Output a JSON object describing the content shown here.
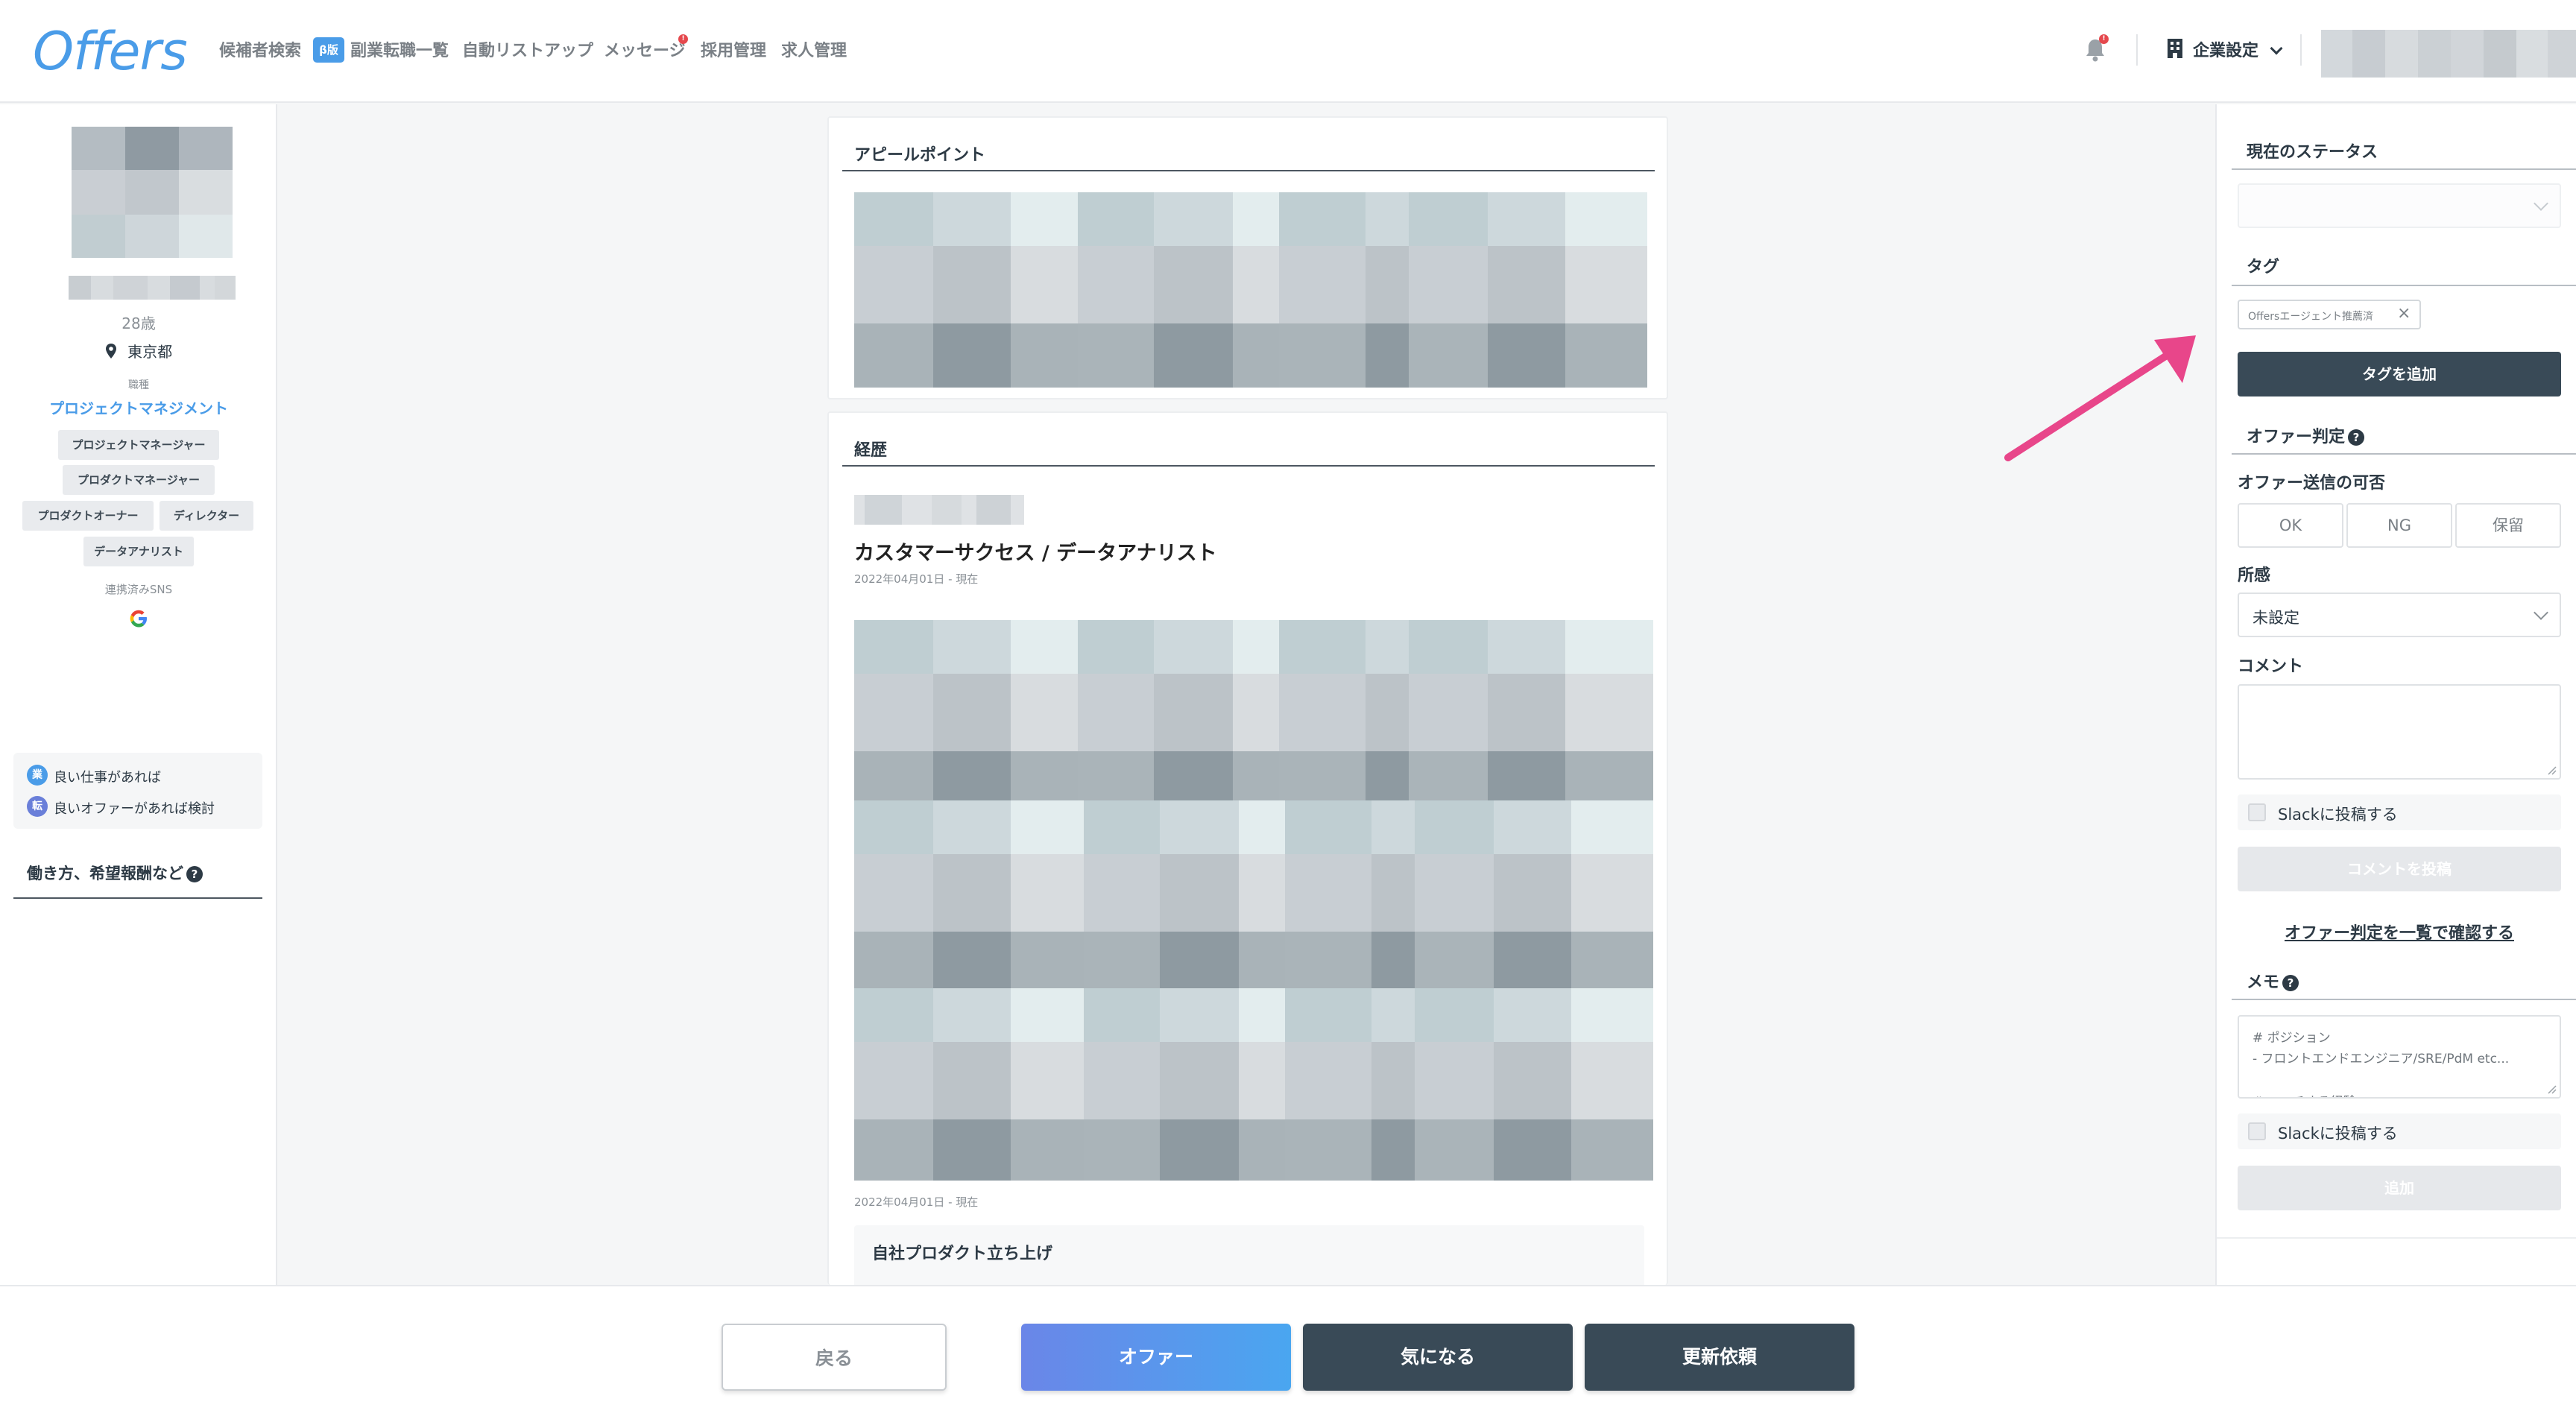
{
  "header": {
    "logo": "Offers",
    "nav": [
      {
        "label": "候補者検索"
      },
      {
        "badge": "β版",
        "label": "副業転職一覧"
      },
      {
        "label": "自動リストアップ"
      },
      {
        "label": "メッセージ",
        "notification": "!"
      },
      {
        "label": "採用管理"
      },
      {
        "label": "求人管理"
      }
    ],
    "bell_notification": "!",
    "company_settings": "企業設定"
  },
  "profile": {
    "age": "28歳",
    "location": "東京都",
    "job_type_label": "職種",
    "job_type": "プロジェクトマネジメント",
    "roles": [
      "プロジェクトマネージャー",
      "プロダクトマネージャー",
      "プロダクトオーナー",
      "ディレクター",
      "データアナリスト"
    ],
    "sns_label": "連携済みSNS",
    "statuses": [
      {
        "icon": "業",
        "text": "良い仕事があれば"
      },
      {
        "icon": "転",
        "text": "良いオファーがあれば検討"
      }
    ],
    "work_style_heading": "働き方、希望報酬など",
    "work_style_help": "?"
  },
  "main": {
    "appeal_title": "アピールポイント",
    "career_title": "経歴",
    "career_entries": [
      {
        "title": "カスタマーサクセス / データアナリスト",
        "date": "2022年04月01日 - 現在"
      },
      {
        "date": "2022年04月01日 - 現在"
      }
    ],
    "project_title": "自社プロダクト立ち上げ"
  },
  "right_panel": {
    "status_heading": "現在のステータス",
    "tag_heading": "タグ",
    "tags": [
      "Offersエージェント推薦済"
    ],
    "add_tag_button": "タグを追加",
    "offer_judgment_heading": "オファー判定",
    "offer_judgment_help": "?",
    "offer_possibility_label": "オファー送信の可否",
    "offer_options": [
      "OK",
      "NG",
      "保留"
    ],
    "affiliation_label": "所感",
    "affiliation_value": "未設定",
    "comment_label": "コメント",
    "slack_post_label": "Slackに投稿する",
    "post_comment_button": "コメントを投稿",
    "view_all_link": "オファー判定を一覧で確認する",
    "memo_heading": "メモ",
    "memo_help": "?",
    "memo_placeholder_line1": "# ポジション",
    "memo_placeholder_line2": "- フロントエンドエンジニア/SRE/PdM etc...",
    "memo_placeholder_line3": "# マッチする経験",
    "memo_slack_post_label": "Slackに投稿する",
    "add_memo_button": "追加"
  },
  "actions": {
    "back": "戻る",
    "offer": "オファー",
    "interested": "気になる",
    "update_request": "更新依頼"
  },
  "colors": {
    "brand": "#4a9ce8",
    "dark_button": "#394a57",
    "annotation_arrow": "#e8468a"
  }
}
